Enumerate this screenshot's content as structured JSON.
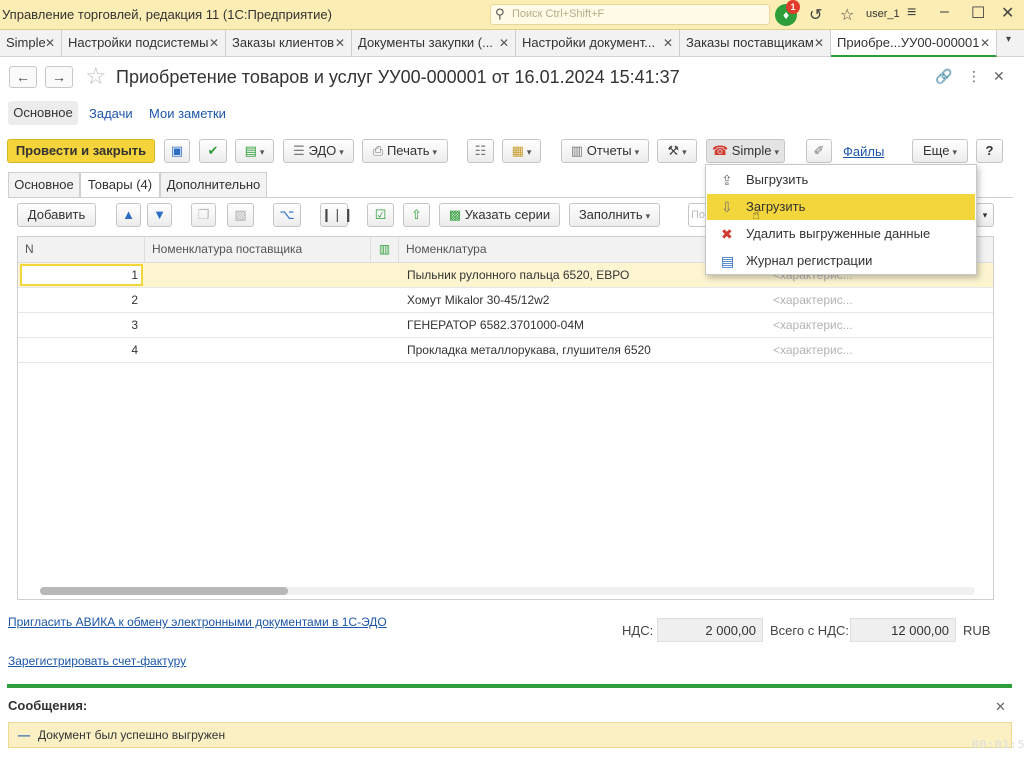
{
  "window": {
    "title": "Управление торговлей, редакция 11  (1С:Предприятие)",
    "search_placeholder": "Поиск Ctrl+Shift+F",
    "notification_count": "1",
    "user": "user_1"
  },
  "tabs": [
    {
      "label": "Simple"
    },
    {
      "label": "Настройки подсистемы"
    },
    {
      "label": "Заказы клиентов"
    },
    {
      "label": "Документы закупки (..."
    },
    {
      "label": "Настройки документ..."
    },
    {
      "label": "Заказы поставщикам"
    },
    {
      "label": "Приобре...УУ00-000001"
    }
  ],
  "document": {
    "title": "Приобретение товаров и услуг УУ00-000001 от 16.01.2024 15:41:37",
    "nav": [
      "Основное",
      "Задачи",
      "Мои заметки"
    ]
  },
  "toolbar": {
    "post_close": "Провести и закрыть",
    "edo": "ЭДО",
    "print": "Печать",
    "reports": "Отчеты",
    "simple": "Simple",
    "files": "Файлы",
    "more": "Еще",
    "help": "?"
  },
  "page_tabs": [
    "Основное",
    "Товары (4)",
    "Дополнительно"
  ],
  "table_toolbar": {
    "add": "Добавить",
    "series": "Указать серии",
    "fill": "Заполнить",
    "search_stub": "По"
  },
  "table": {
    "columns": [
      "N",
      "Номенклатура поставщика",
      "Номенклатура"
    ],
    "rows": [
      {
        "n": "1",
        "supplier_item": "",
        "item": "Пыльник рулонного пальца 6520, ЕВРО",
        "feature": "<характерис..."
      },
      {
        "n": "2",
        "supplier_item": "",
        "item": "Хомут Mikalor 30-45/12w2",
        "feature": "<характерис..."
      },
      {
        "n": "3",
        "supplier_item": "",
        "item": "ГЕНЕРАТОР 6582.3701000-04М",
        "feature": "<характерис..."
      },
      {
        "n": "4",
        "supplier_item": "",
        "item": "Прокладка металлорукава, глушителя 6520",
        "feature": "<характерис..."
      }
    ],
    "selected_row": 1
  },
  "menu": {
    "items": [
      {
        "label": "Выгрузить",
        "icon": "upload-icon"
      },
      {
        "label": "Загрузить",
        "icon": "download-icon"
      },
      {
        "label": "Удалить выгруженные данные",
        "icon": "delete-icon"
      },
      {
        "label": "Журнал регистрации",
        "icon": "journal-icon"
      }
    ],
    "highlighted": 1
  },
  "footer": {
    "invite_link": "Пригласить АВИКА к обмену электронными документами в 1С-ЭДО",
    "register_link": "Зарегистрировать счет-фактуру",
    "vat_label": "НДС:",
    "vat_value": "2 000,00",
    "total_label": "Всего с НДС:",
    "total_value": "12 000,00",
    "currency": "RUB"
  },
  "messages": {
    "title": "Сообщения:",
    "text": "Документ был успешно выгружен"
  },
  "overlay_timer": "00:01:5"
}
